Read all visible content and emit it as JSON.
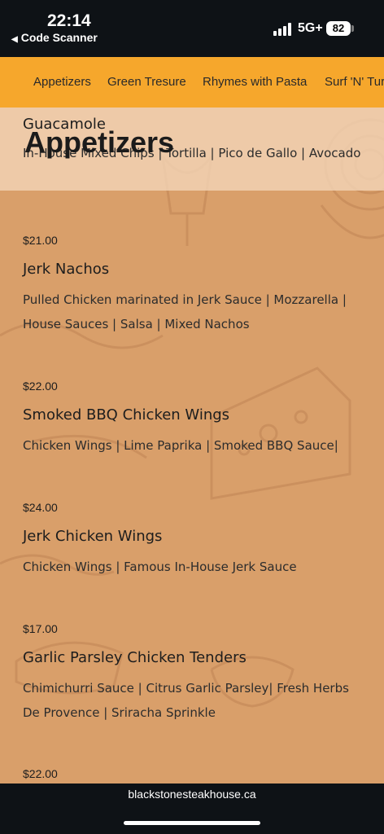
{
  "status_bar": {
    "time": "22:14",
    "back_label": "Code Scanner",
    "back_arrow": "◀",
    "network": "5G+",
    "battery": "82"
  },
  "nav": {
    "items": [
      "Appetizers",
      "Green Tresure",
      "Rhymes with Pasta",
      "Surf 'N' Turf"
    ]
  },
  "section": {
    "title": "Appetizers"
  },
  "menu_items": [
    {
      "name": "Guacamole",
      "desc": "In-House Mixed Chips | Tortilla | Pico de Gallo | Avocado"
    },
    {
      "price": "$21.00",
      "name": "Jerk Nachos",
      "desc": "Pulled Chicken marinated in Jerk Sauce | Mozzarella | House Sauces | Salsa | Mixed Nachos"
    },
    {
      "price": "$22.00",
      "name": "Smoked BBQ Chicken Wings",
      "desc": "Chicken Wings | Lime Paprika | Smoked BBQ Sauce|"
    },
    {
      "price": "$24.00",
      "name": "Jerk Chicken Wings",
      "desc": "Chicken Wings | Famous In-House Jerk Sauce"
    },
    {
      "price": "$17.00",
      "name": "Garlic Parsley Chicken Tenders",
      "desc": "Chimichurri Sauce | Citrus Garlic Parsley| Fresh Herbs De Provence | Sriracha Sprinkle"
    },
    {
      "price": "$22.00"
    }
  ],
  "footer": {
    "url": "blackstonesteakhouse.ca"
  },
  "colors": {
    "nav_bg": "#f6a72c",
    "content_bg": "#d99f6a",
    "bar_bg": "#0e1216"
  }
}
